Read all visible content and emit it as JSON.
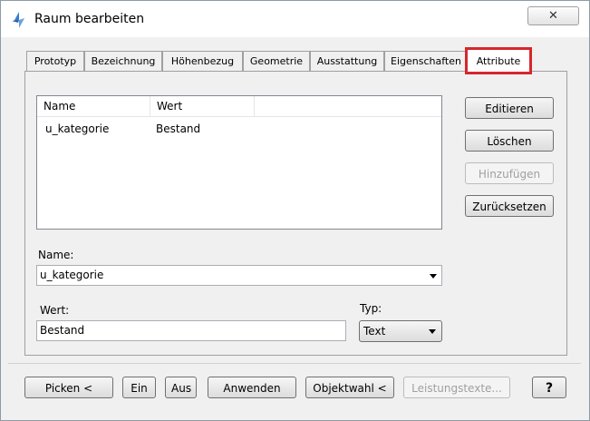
{
  "window": {
    "title": "Raum bearbeiten",
    "close_glyph": "✕"
  },
  "tabs": [
    {
      "label": "Prototyp"
    },
    {
      "label": "Bezeichnung"
    },
    {
      "label": "Höhenbezug"
    },
    {
      "label": "Geometrie"
    },
    {
      "label": "Ausstattung"
    },
    {
      "label": "Eigenschaften"
    },
    {
      "label": "Attribute",
      "active": true
    }
  ],
  "table": {
    "columns": [
      "Name",
      "Wert"
    ],
    "rows": [
      {
        "name": "u_kategorie",
        "wert": "Bestand"
      }
    ]
  },
  "side_buttons": {
    "edit": "Editieren",
    "delete": "Löschen",
    "add": "Hinzufügen",
    "reset": "Zurücksetzen"
  },
  "form": {
    "name_label": "Name:",
    "name_value": "u_kategorie",
    "wert_label": "Wert:",
    "wert_value": "Bestand",
    "typ_label": "Typ:",
    "typ_value": "Text"
  },
  "bottom_buttons": {
    "pick": "Picken <",
    "on": "Ein",
    "off": "Aus",
    "apply": "Anwenden",
    "object_select": "Objektwahl <",
    "service_texts": "Leistungstexte...",
    "help": "?"
  },
  "colors": {
    "highlight_frame": "#d6262d",
    "window_bg": "#f0f0f0"
  }
}
